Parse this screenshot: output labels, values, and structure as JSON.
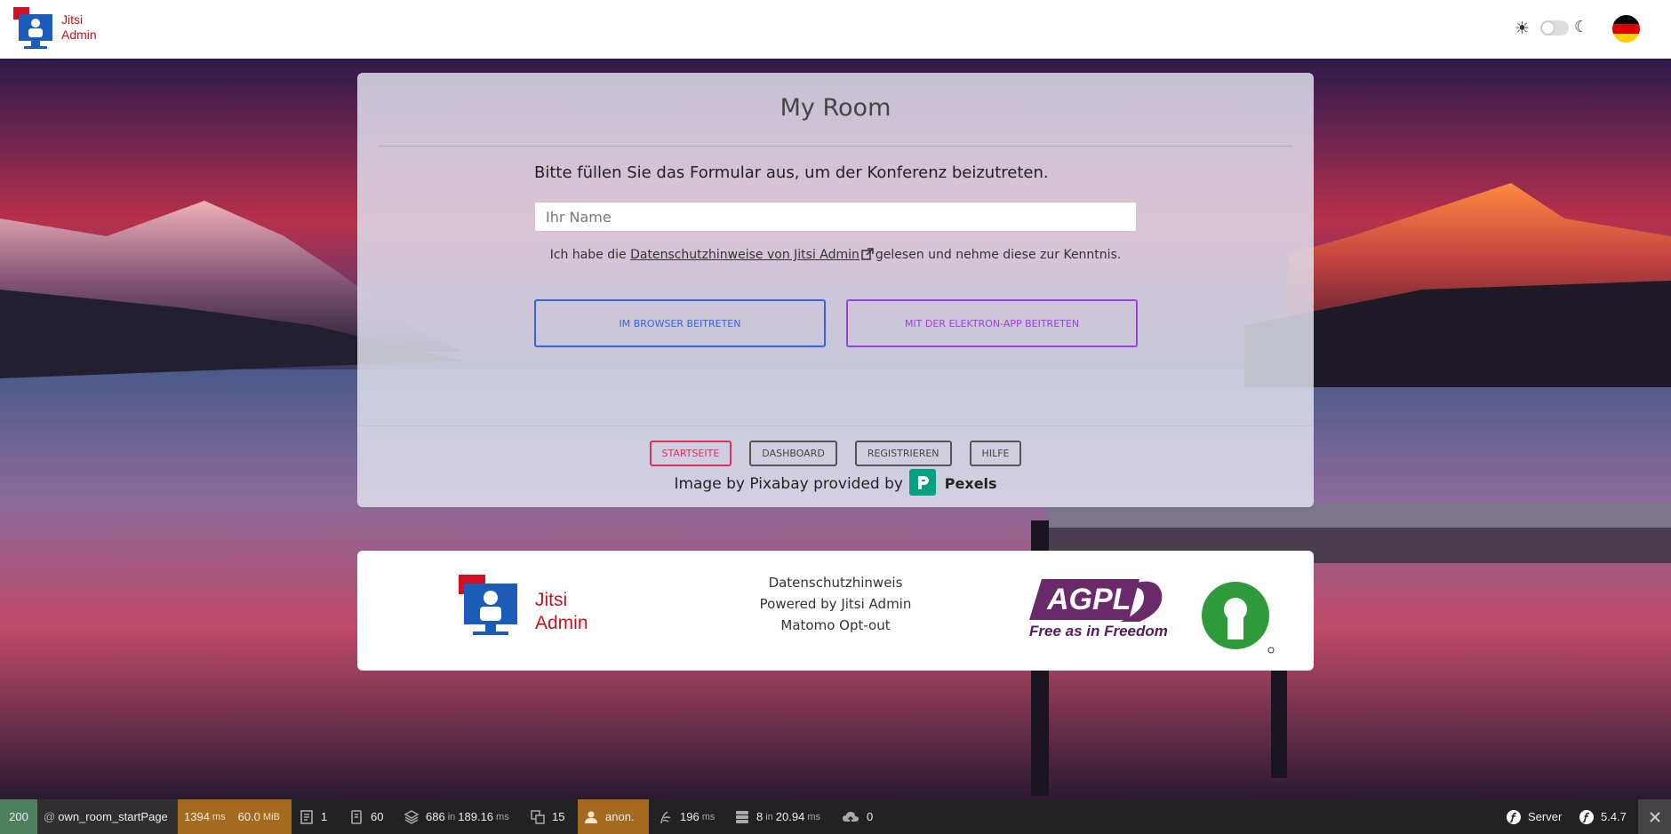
{
  "brand": {
    "line1": "Jitsi",
    "line2": "Admin"
  },
  "language_flag": "de",
  "room": {
    "title": "My Room",
    "intro": "Bitte füllen Sie das Formular aus, um der Konferenz beizutreten.",
    "name_placeholder": "Ihr Name",
    "privacy_prefix": "Ich habe die",
    "privacy_link": "Datenschutzhinweise von Jitsi Admin",
    "privacy_suffix": "gelesen und nehme diese zur Kenntnis.",
    "btn_browser": "IM BROWSER BEITRETEN",
    "btn_electron": "MIT DER ELEKTRON-APP BEITRETEN"
  },
  "nav": {
    "start": "STARTSEITE",
    "dashboard": "DASHBOARD",
    "register": "REGISTRIEREN",
    "help": "HILFE"
  },
  "credit": {
    "text": "Image by Pixabay provided by",
    "provider": "Pexels"
  },
  "footer": {
    "privacy": "Datenschutzhinweis",
    "powered": "Powered by Jitsi Admin",
    "matomo": "Matomo Opt-out"
  },
  "toolbar": {
    "status": "200",
    "route": "own_room_startPage",
    "time": "1394",
    "time_unit": "ms",
    "memory": "60.0",
    "memory_unit": "MiB",
    "forms": "1",
    "logs": "60",
    "cache": "686",
    "cache_time": "189.16",
    "cache_unit": "ms",
    "translations": "15",
    "user": "anon.",
    "twig": "196",
    "twig_unit": "ms",
    "db": "8",
    "db_time": "20.94",
    "db_unit": "ms",
    "upload": "0",
    "server": "Server",
    "version": "5.4.7",
    "in_label": "in"
  },
  "colors": {
    "brand_red": "#c8101e",
    "browser_btn": "#3565e0",
    "electron_btn": "#a03ee0",
    "active_nav": "#e0305a",
    "pexels": "#05a081",
    "toolbar_time_bg": "#a46a1f"
  }
}
